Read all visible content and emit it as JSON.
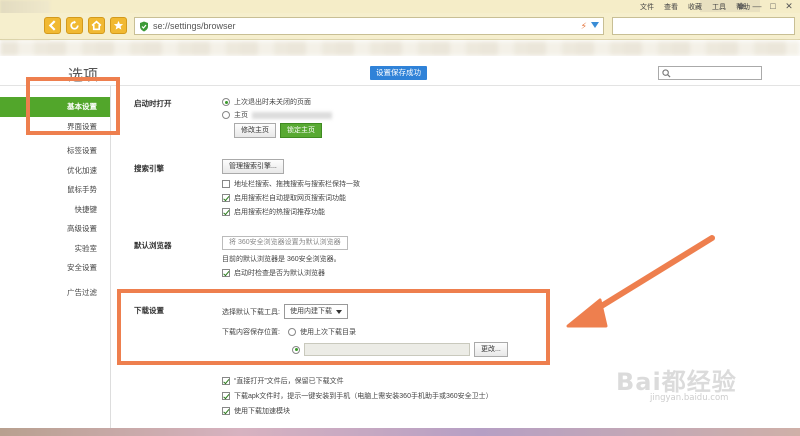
{
  "browser": {
    "menu": [
      "文件",
      "查看",
      "收藏",
      "工具",
      "帮助"
    ],
    "address": "se://settings/browser",
    "win_buttons": [
      "♚",
      "—",
      "□",
      "✕"
    ]
  },
  "page": {
    "title": "选项",
    "saved_badge": "设置保存成功"
  },
  "sidebar": {
    "items": [
      "基本设置",
      "界面设置",
      "标签设置",
      "优化加速",
      "鼠标手势",
      "快捷键",
      "高级设置",
      "实验室",
      "安全设置",
      "广告过滤"
    ]
  },
  "sections": {
    "startup": {
      "label": "启动时打开",
      "opt_last": "上次退出时未关闭的页面",
      "opt_home": "主页",
      "btn_modify": "修改主页",
      "btn_lock": "锁定主页"
    },
    "search": {
      "label": "搜索引擎",
      "btn_manage": "管理搜索引擎...",
      "opt_sync": "地址栏搜索、拖拽搜索与搜索栏保持一致",
      "opt_suggest": "启用搜索栏自动提取网页搜索词功能",
      "opt_hot": "启用搜索栏的热搜词推荐功能"
    },
    "default_browser": {
      "label": "默认浏览器",
      "btn_set": "将 360安全浏览器设置为默认浏览器",
      "status": "目前的默认浏览器是 360安全浏览器。",
      "opt_check": "启动时检查是否为默认浏览器"
    },
    "download": {
      "label": "下载设置",
      "tool_label": "选择默认下载工具:",
      "tool_value": "使用内建下载",
      "path_label": "下载内容保存位置:",
      "opt_last_dir": "使用上次下载目录",
      "btn_change": "更改...",
      "opt_keep": "“直接打开”文件后，保留已下载文件",
      "opt_apk": "下载apk文件时，提示一键安装到手机（电脑上需安装360手机助手或360安全卫士）",
      "opt_accel": "使用下载加速模块"
    }
  },
  "watermark": {
    "main": "Bai都经验",
    "sub": "jingyan.baidu.com"
  },
  "colors": {
    "accent_green": "#52a62b",
    "badge_blue": "#2f82d8",
    "highlight_orange": "#ee7f4e"
  }
}
